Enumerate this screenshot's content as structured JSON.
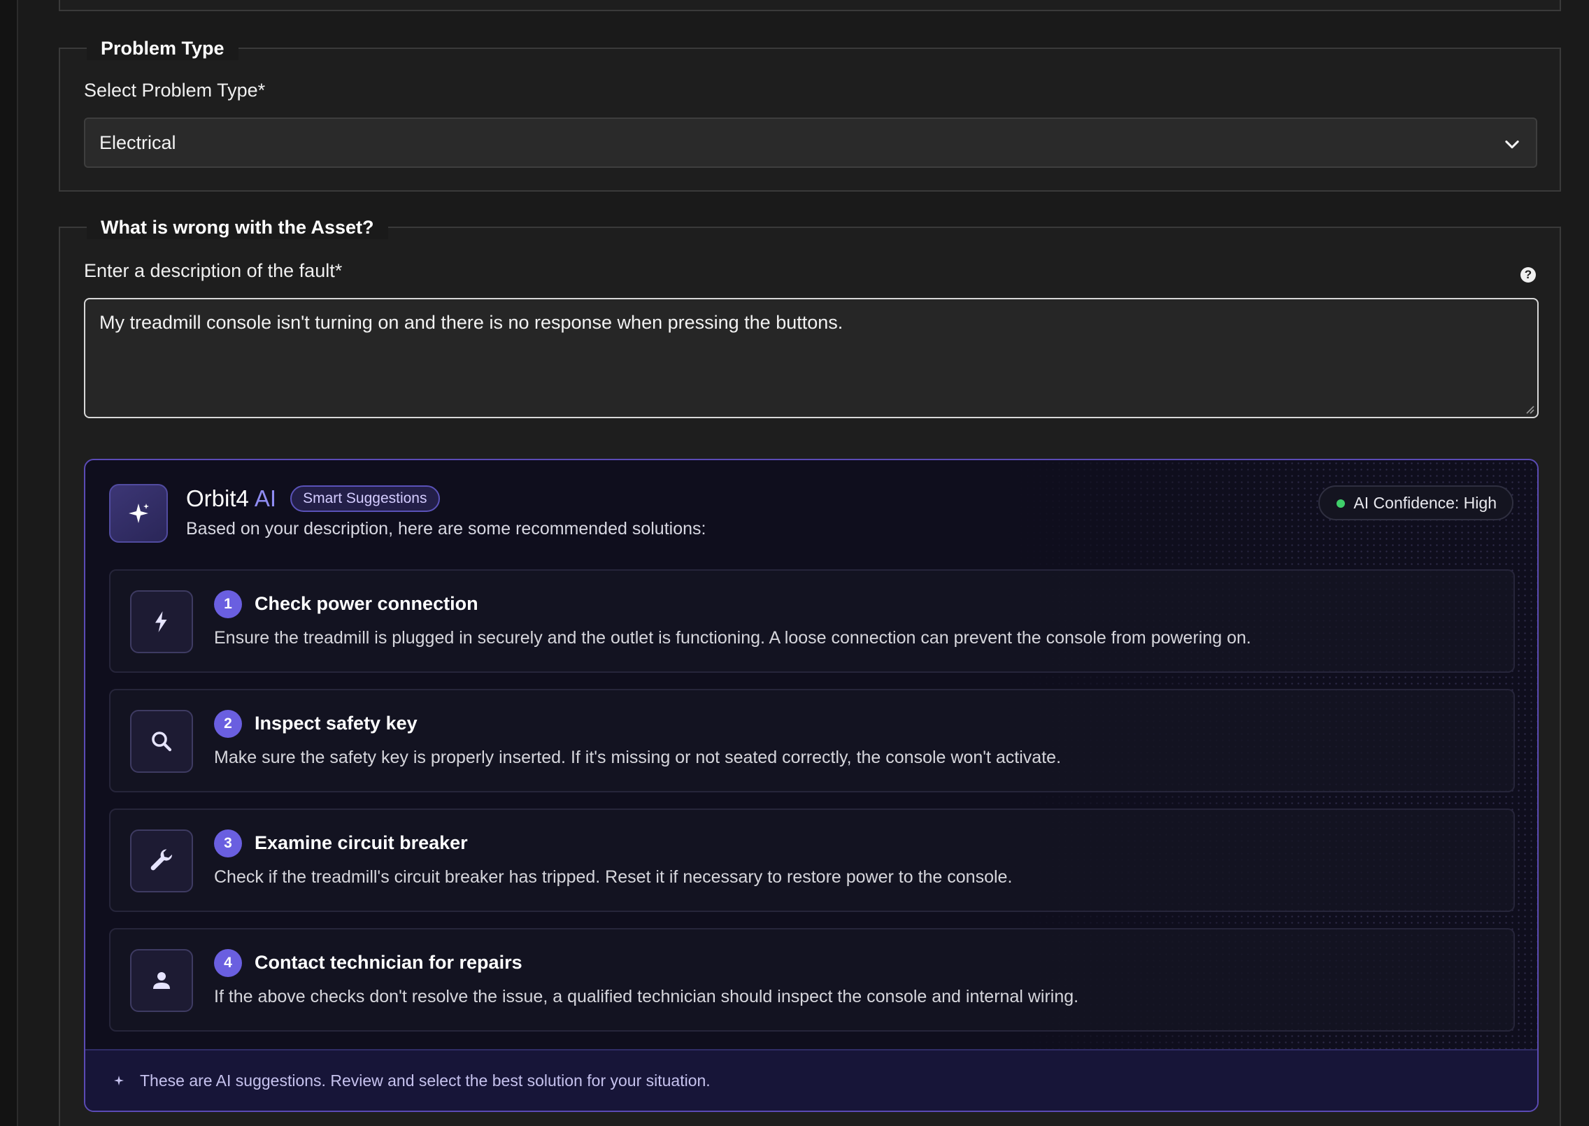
{
  "problem_type_section": {
    "legend": "Problem Type",
    "select_label": "Select Problem Type*",
    "selected_value": "Electrical"
  },
  "fault_section": {
    "legend": "What is wrong with the Asset?",
    "description_label": "Enter a description of the fault*",
    "help_icon": "?",
    "description_value": "My treadmill console isn't turning on and there is no response when pressing the buttons."
  },
  "ai_panel": {
    "brand": "Orbit4",
    "brand_ai": "AI",
    "badge": "Smart Suggestions",
    "subtitle": "Based on your description, here are some recommended solutions:",
    "confidence": "AI Confidence: High",
    "suggestions": [
      {
        "number": "1",
        "icon": "lightning-icon",
        "title": "Check power connection",
        "description": "Ensure the treadmill is plugged in securely and the outlet is functioning. A loose connection can prevent the console from powering on."
      },
      {
        "number": "2",
        "icon": "search-icon",
        "title": "Inspect safety key",
        "description": "Make sure the safety key is properly inserted. If it's missing or not seated correctly, the console won't activate."
      },
      {
        "number": "3",
        "icon": "wrench-icon",
        "title": "Examine circuit breaker",
        "description": "Check if the treadmill's circuit breaker has tripped. Reset it if necessary to restore power to the console."
      },
      {
        "number": "4",
        "icon": "person-icon",
        "title": "Contact technician for repairs",
        "description": "If the above checks don't resolve the issue, a qualified technician should inspect the console and internal wiring."
      }
    ],
    "footer_note": "These are AI suggestions. Review and select the best solution for your situation."
  },
  "colors": {
    "accent": "#6a5fe0",
    "confidence_dot": "#3fcf6a",
    "panel_border": "#5b4bb5"
  }
}
